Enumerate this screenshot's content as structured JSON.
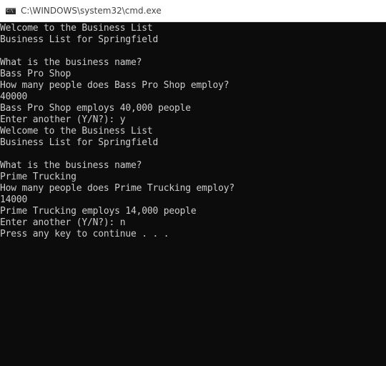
{
  "window": {
    "title": "C:\\WINDOWS\\system32\\cmd.exe",
    "icon": "cmd-icon",
    "icon_glyph": "C:\\"
  },
  "console": {
    "lines": [
      "Welcome to the Business List",
      "Business List for Springfield",
      "",
      "What is the business name?",
      "Bass Pro Shop",
      "How many people does Bass Pro Shop employ?",
      "40000",
      "Bass Pro Shop employs 40,000 people",
      "Enter another (Y/N?): y",
      "Welcome to the Business List",
      "Business List for Springfield",
      "",
      "What is the business name?",
      "Prime Trucking",
      "How many people does Prime Trucking employ?",
      "14000",
      "Prime Trucking employs 14,000 people",
      "Enter another (Y/N?): n",
      "Press any key to continue . . ."
    ]
  },
  "colors": {
    "console_background": "#0c0c0c",
    "console_text": "#cccccc",
    "titlebar_background": "#ffffff",
    "title_text": "#444444"
  }
}
